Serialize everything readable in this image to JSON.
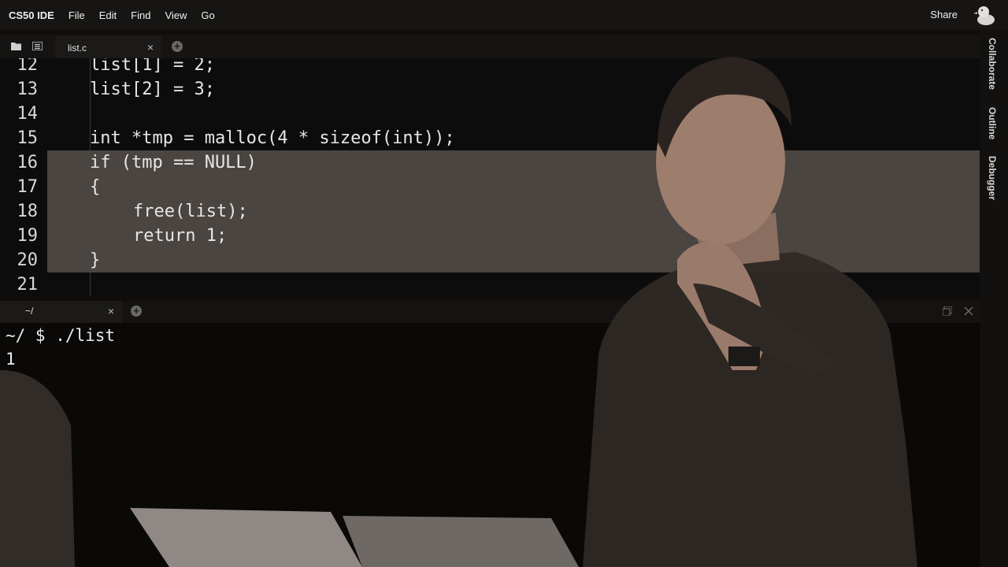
{
  "menubar": {
    "brand": "CS50 IDE",
    "items": [
      "File",
      "Edit",
      "Find",
      "View",
      "Go"
    ],
    "share": "Share"
  },
  "editor_tab": {
    "label": "list.c",
    "close": "×",
    "add": "+"
  },
  "code_lines": [
    {
      "num": "12",
      "text": "list[1] = 2;",
      "indent": 1
    },
    {
      "num": "13",
      "text": "list[2] = 3;",
      "indent": 1
    },
    {
      "num": "14",
      "text": "",
      "indent": 0
    },
    {
      "num": "15",
      "text": "int *tmp = malloc(4 * sizeof(int));",
      "indent": 1
    },
    {
      "num": "16",
      "text": "if (tmp == NULL)",
      "indent": 1,
      "selected": true
    },
    {
      "num": "17",
      "text": "{",
      "indent": 1,
      "selected": true
    },
    {
      "num": "18",
      "text": "free(list);",
      "indent": 2,
      "selected": true
    },
    {
      "num": "19",
      "text": "return 1;",
      "indent": 2,
      "selected": true
    },
    {
      "num": "20",
      "text": "}",
      "indent": 1,
      "selected": true
    },
    {
      "num": "21",
      "text": "",
      "indent": 0
    }
  ],
  "terminal_tab": {
    "label": "~/",
    "close": "×",
    "add": "+"
  },
  "terminal_lines": [
    "~/ $ ./list",
    "1"
  ],
  "side_panel": [
    "Collaborate",
    "Outline",
    "Debugger"
  ],
  "colors": {
    "selection": "#4a4541",
    "editor_bg": "#0d0c0c",
    "terminal_bg": "#0a0908",
    "menubar_bg": "#161514"
  }
}
